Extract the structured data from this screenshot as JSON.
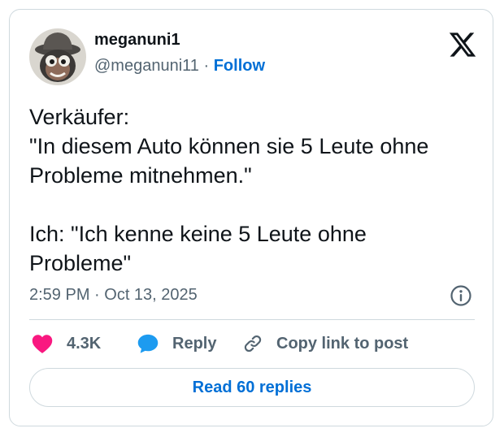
{
  "author": {
    "display_name": "meganuni1",
    "handle": "@meganuni11",
    "separator": "·",
    "follow_label": "Follow",
    "avatar_icon": "cartoon-character-avatar"
  },
  "platform_icon": "x-logo-icon",
  "tweet": {
    "lines": [
      "Verkäufer:",
      "\"In diesem Auto können sie 5 Leute ohne",
      "Probleme mitnehmen.\"",
      "",
      "Ich: \"Ich kenne keine 5 Leute ohne",
      "Probleme\""
    ]
  },
  "meta": {
    "timestamp": "2:59 PM · Oct 13, 2025",
    "info_icon": "info-icon"
  },
  "actions": {
    "like_count": "4.3K",
    "reply_label": "Reply",
    "copy_link_label": "Copy link to post"
  },
  "read_replies_label": "Read 60 replies",
  "colors": {
    "like": "#f91880",
    "reply": "#1d9bf0",
    "link": "#006fd6",
    "text_primary": "#0f1419",
    "text_secondary": "#536471",
    "border": "#cfd9de"
  }
}
